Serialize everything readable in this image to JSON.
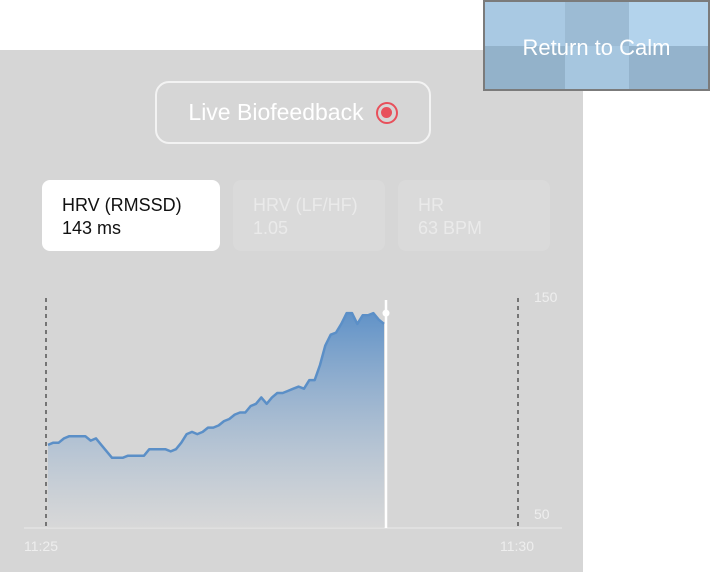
{
  "header": {
    "calm_button_label": "Return to Calm"
  },
  "live": {
    "label": "Live Biofeedback",
    "icon": "record-icon",
    "icon_color": "#e8505b"
  },
  "metrics": [
    {
      "name": "HRV (RMSSD)",
      "value": "143 ms",
      "active": true
    },
    {
      "name": "HRV (LF/HF)",
      "value": "1.05",
      "active": false
    },
    {
      "name": "HR",
      "value": "63 BPM",
      "active": false
    }
  ],
  "colors": {
    "accent_blue": "#5b8fc7",
    "panel_bg": "#d6d6d6",
    "cursor": "#ffffff"
  },
  "chart_data": {
    "type": "area",
    "title": "",
    "xlabel": "",
    "ylabel": "",
    "x_tick_labels": [
      "11:25",
      "11:30"
    ],
    "y_tick_labels": [
      "150",
      "50"
    ],
    "ylim": [
      50,
      150
    ],
    "grid": false,
    "cursor_value": 143,
    "series": [
      {
        "values": [
          82,
          83,
          83,
          85,
          86,
          86,
          86,
          86,
          84,
          85,
          82,
          79,
          76,
          76,
          76,
          77,
          77,
          77,
          77,
          80,
          80,
          80,
          80,
          79,
          80,
          83,
          87,
          88,
          87,
          88,
          90,
          90,
          91,
          93,
          94,
          96,
          97,
          97,
          100,
          101,
          104,
          101,
          104,
          106,
          106,
          107,
          108,
          109,
          108,
          112,
          112,
          119,
          128,
          133,
          134,
          138,
          143,
          143,
          138,
          142,
          142,
          143,
          140,
          138
        ]
      }
    ]
  }
}
